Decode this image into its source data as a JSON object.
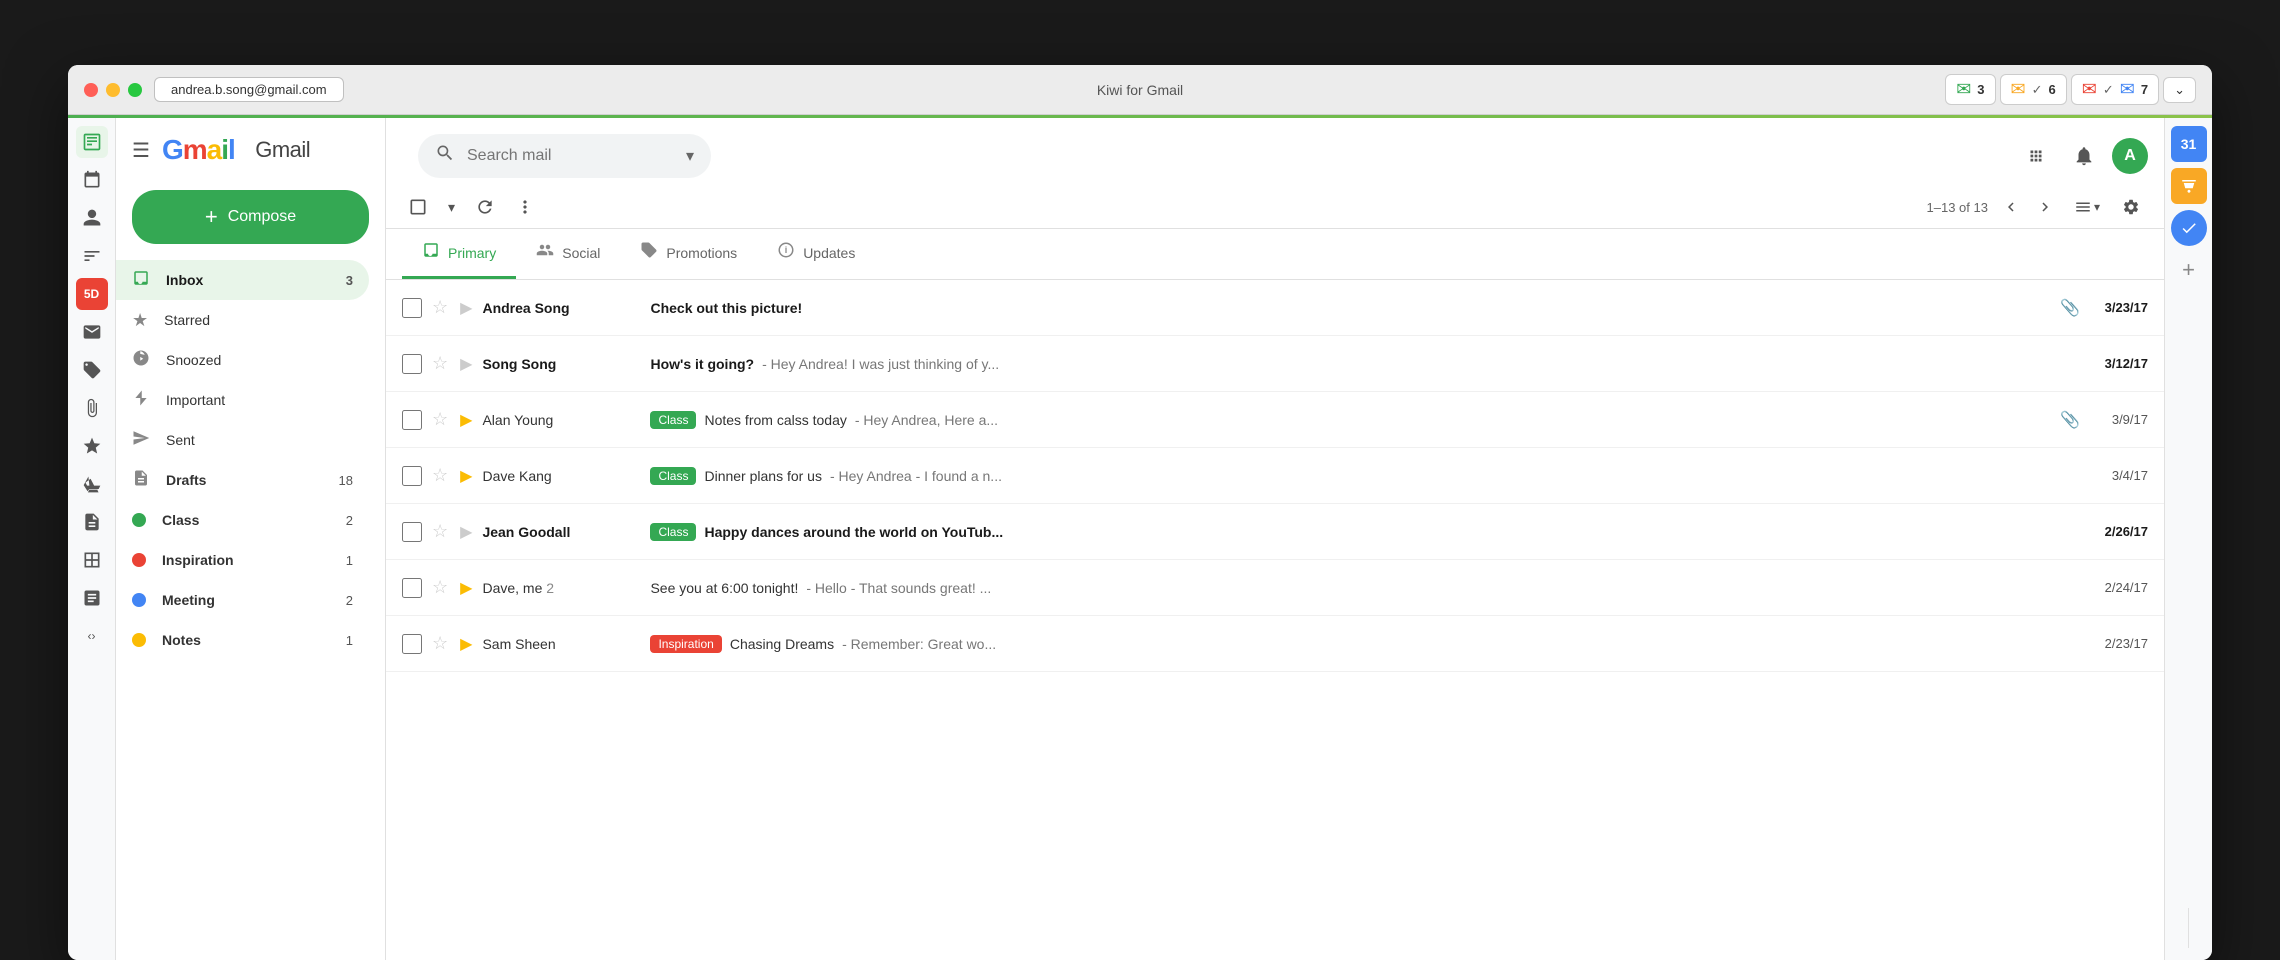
{
  "window": {
    "title": "Kiwi for Gmail",
    "address_tab": "andrea.b.song@gmail.com",
    "traffic_lights": [
      "close",
      "minimize",
      "maximize"
    ]
  },
  "toolbar_groups": [
    {
      "icon": "✉",
      "badge": "3",
      "check": "✓"
    },
    {
      "icon": "✉",
      "badge": "6",
      "check": "✓"
    },
    {
      "icon": "✉",
      "badge": "7"
    }
  ],
  "sidebar": {
    "compose_label": "Compose",
    "nav_items": [
      {
        "id": "inbox",
        "icon": "☰",
        "label": "Inbox",
        "count": "3",
        "active": true
      },
      {
        "id": "starred",
        "icon": "★",
        "label": "Starred",
        "count": "",
        "active": false
      },
      {
        "id": "snoozed",
        "icon": "🕐",
        "label": "Snoozed",
        "count": "",
        "active": false
      },
      {
        "id": "important",
        "icon": "▶",
        "label": "Important",
        "count": "",
        "active": false
      },
      {
        "id": "sent",
        "icon": "▶",
        "label": "Sent",
        "count": "",
        "active": false
      },
      {
        "id": "drafts",
        "icon": "📄",
        "label": "Drafts",
        "count": "18",
        "active": false
      },
      {
        "id": "class",
        "icon": "●",
        "label": "Class",
        "count": "2",
        "active": false,
        "dot_color": "#34a853"
      },
      {
        "id": "inspiration",
        "icon": "●",
        "label": "Inspiration",
        "count": "1",
        "active": false,
        "dot_color": "#ea4335"
      },
      {
        "id": "meeting",
        "icon": "●",
        "label": "Meeting",
        "count": "2",
        "active": false,
        "dot_color": "#4285f4"
      },
      {
        "id": "notes",
        "icon": "●",
        "label": "Notes",
        "count": "1",
        "active": false,
        "dot_color": "#fbbc04"
      }
    ]
  },
  "search": {
    "placeholder": "Search mail"
  },
  "tabs": [
    {
      "id": "primary",
      "label": "Primary",
      "icon": "☰",
      "active": true
    },
    {
      "id": "social",
      "label": "Social",
      "icon": "👥",
      "active": false
    },
    {
      "id": "promotions",
      "label": "Promotions",
      "icon": "🏷",
      "active": false
    },
    {
      "id": "updates",
      "label": "Updates",
      "icon": "ℹ",
      "active": false
    }
  ],
  "pagination": {
    "info": "1–13 of 13"
  },
  "emails": [
    {
      "id": 1,
      "sender": "Andrea Song",
      "star": false,
      "important": false,
      "subject": "Check out this picture!",
      "preview": "",
      "tag": null,
      "attachment": true,
      "date": "3/23/17",
      "unread": true
    },
    {
      "id": 2,
      "sender": "Song Song",
      "star": false,
      "important": false,
      "subject": "How's it going?",
      "preview": "- Hey Andrea! I was just thinking of y...",
      "tag": null,
      "attachment": false,
      "date": "3/12/17",
      "unread": true
    },
    {
      "id": 3,
      "sender": "Alan Young",
      "star": false,
      "important": true,
      "subject": "Notes from calss today",
      "preview": "- Hey Andrea, Here a...",
      "tag": "Class",
      "tag_type": "class",
      "attachment": true,
      "date": "3/9/17",
      "unread": false
    },
    {
      "id": 4,
      "sender": "Dave Kang",
      "star": false,
      "important": true,
      "subject": "Dinner plans for us",
      "preview": "- Hey Andrea - I found a n...",
      "tag": "Class",
      "tag_type": "class",
      "attachment": false,
      "date": "3/4/17",
      "unread": false
    },
    {
      "id": 5,
      "sender": "Jean Goodall",
      "star": false,
      "important": false,
      "subject": "Happy dances around the world on YouTub...",
      "preview": "",
      "tag": "Class",
      "tag_type": "class",
      "attachment": false,
      "date": "2/26/17",
      "unread": true
    },
    {
      "id": 6,
      "sender": "Dave, me",
      "sender_count": "2",
      "star": false,
      "important": true,
      "subject": "See you at 6:00 tonight!",
      "preview": "- Hello - That sounds great! ...",
      "tag": null,
      "attachment": false,
      "date": "2/24/17",
      "unread": false
    },
    {
      "id": 7,
      "sender": "Sam Sheen",
      "star": false,
      "important": true,
      "subject": "Chasing Dreams",
      "preview": "- Remember: Great wo...",
      "tag": "Inspiration",
      "tag_type": "inspiration",
      "attachment": false,
      "date": "2/23/17",
      "unread": false
    }
  ],
  "header_icons": {
    "apps_label": "Apps",
    "notifications_label": "Notifications",
    "avatar_label": "A"
  },
  "calendar_date": "31"
}
